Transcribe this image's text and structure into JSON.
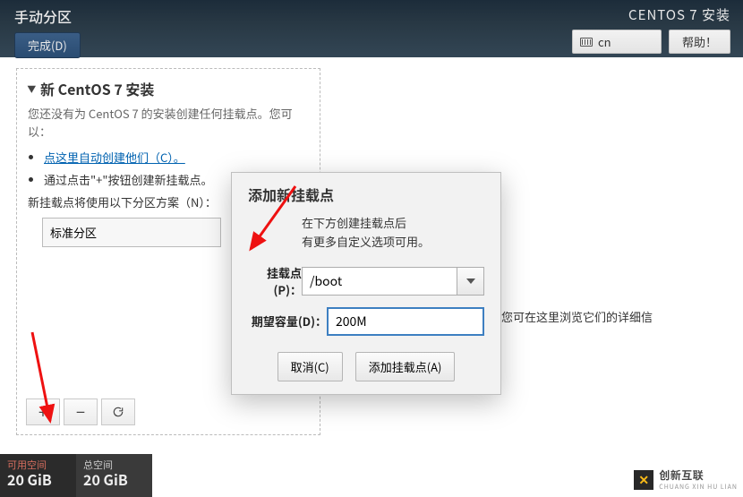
{
  "header": {
    "screen_title": "手动分区",
    "done_label": "完成(D)",
    "installer_title": "CENTOS 7 安装",
    "lang_indicator": "cn",
    "help_label": "帮助！"
  },
  "sidebar": {
    "section_title": "新 CentOS 7 安装",
    "description": "您还没有为 CentOS 7 的安装创建任何挂载点。您可以：",
    "auto_link": "点这里自动创建他们（C）。",
    "manual_hint": "通过点击\"+\"按钮创建新挂载点。",
    "scheme_hint": "新挂载点将使用以下分区方案（N）：",
    "scheme_value": "标准分区"
  },
  "right": {
    "hint": "载点后，您可在这里浏览它们的详细信"
  },
  "dialog": {
    "title": "添加新挂载点",
    "desc_line1": "在下方创建挂载点后",
    "desc_line2": "有更多自定义选项可用。",
    "mountpoint_label": "挂载点(P)：",
    "mountpoint_value": "/boot",
    "capacity_label": "期望容量(D)：",
    "capacity_value": "200M",
    "cancel_label": "取消(C)",
    "confirm_label": "添加挂载点(A)"
  },
  "footer": {
    "avail_label": "可用空间",
    "avail_value": "20 GiB",
    "total_label": "总空间",
    "total_value": "20 GiB"
  },
  "watermark": {
    "brand": "创新互联",
    "sub": "CHUANG XIN HU LIAN"
  },
  "colors": {
    "accent": "#3d7fc1",
    "topbar": "#2a3e50",
    "annot": "#e11"
  }
}
